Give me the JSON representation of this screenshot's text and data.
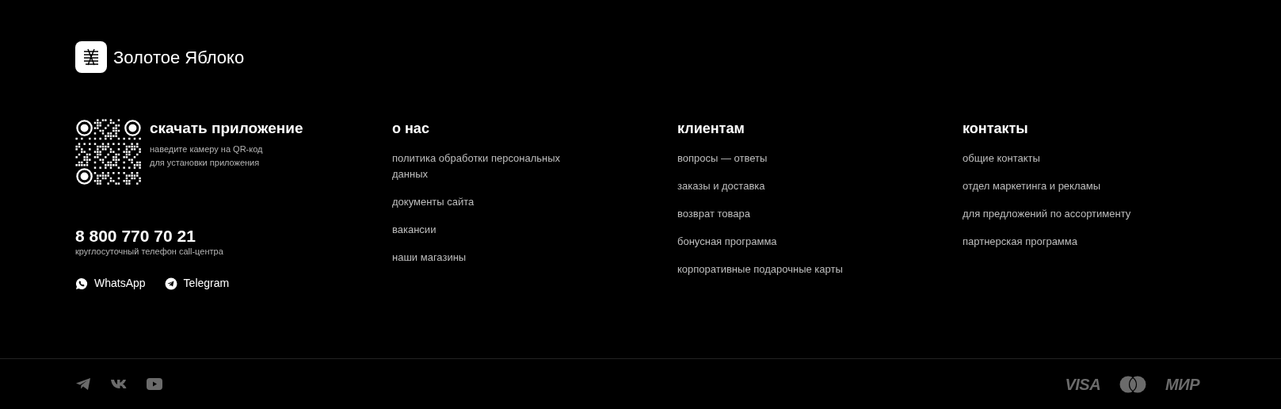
{
  "brand": {
    "name": "Золотое Яблоко"
  },
  "app": {
    "title": "скачать приложение",
    "hint_lines": [
      "наведите камеру на QR-код",
      "для установки приложения"
    ]
  },
  "phone": {
    "number": "8 800 770 70 21",
    "caption": "круглосуточный телефон call-центра"
  },
  "messengers": [
    {
      "kind": "whatsapp",
      "label": "WhatsApp"
    },
    {
      "kind": "telegram",
      "label": "Telegram"
    }
  ],
  "columns": [
    {
      "title": "о нас",
      "links": [
        "политика обработки персональных данных",
        "документы сайта",
        "вакансии",
        "наши магазины"
      ]
    },
    {
      "title": "клиентам",
      "links": [
        "вопросы — ответы",
        "заказы и доставка",
        "возврат товара",
        "бонусная программа",
        "корпоративные подарочные карты"
      ]
    },
    {
      "title": "контакты",
      "links": [
        "общие контакты",
        "отдел маркетинга и рекламы",
        "для предложений по ассортименту",
        "партнерская программа"
      ]
    }
  ],
  "socials": [
    {
      "kind": "telegram"
    },
    {
      "kind": "vk"
    },
    {
      "kind": "youtube"
    }
  ],
  "payments": [
    {
      "kind": "visa",
      "label": "VISA"
    },
    {
      "kind": "mastercard"
    },
    {
      "kind": "mir",
      "label": "МИР"
    }
  ]
}
